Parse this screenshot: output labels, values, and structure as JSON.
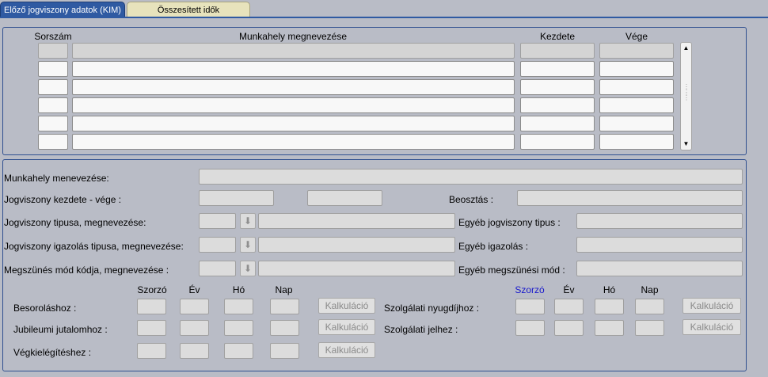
{
  "tabs": [
    {
      "label": "Előző jogviszony adatok (KIM)"
    },
    {
      "label": "Összesített idők"
    }
  ],
  "table": {
    "headers": {
      "sorszam": "Sorszám",
      "munkahely": "Munkahely megnevezése",
      "kezdete": "Kezdete",
      "vege": "Vége"
    },
    "rows": 6
  },
  "details": {
    "munkahely_label": "Munkahely menevezése:",
    "jogviszony_kezdete_label": "Jogviszony kezdete - vége :",
    "beosztas_label": "Beosztás :",
    "jogviszony_tipusa_label": "Jogviszony tipusa, megnevezése:",
    "egyeb_jogviszony_label": "Egyéb jogviszony tipus :",
    "igazolas_label": "Jogviszony igazolás tipusa, megnevezése:",
    "egyeb_igazolas_label": "Egyéb igazolás :",
    "megszunes_label": "Megszünés mód kódja, megnevezése :",
    "egyeb_megszunes_label": "Egyéb megszünési mód :"
  },
  "calc": {
    "left_headers": {
      "szorzo": "Szorzó",
      "ev": "Év",
      "ho": "Hó",
      "nap": "Nap"
    },
    "right_headers": {
      "szorzo": "Szorzó",
      "ev": "Év",
      "ho": "Hó",
      "nap": "Nap"
    },
    "rows_left": [
      {
        "label": "Besoroláshoz :"
      },
      {
        "label": "Jubileumi jutalomhoz :"
      },
      {
        "label": "Végkielégítéshez :"
      }
    ],
    "rows_right": [
      {
        "label": "Szolgálati nyugdíjhoz :"
      },
      {
        "label": "Szolgálati jelhez :"
      }
    ],
    "button_label": "Kalkuláció",
    "accent_color": "#1a1acc"
  }
}
